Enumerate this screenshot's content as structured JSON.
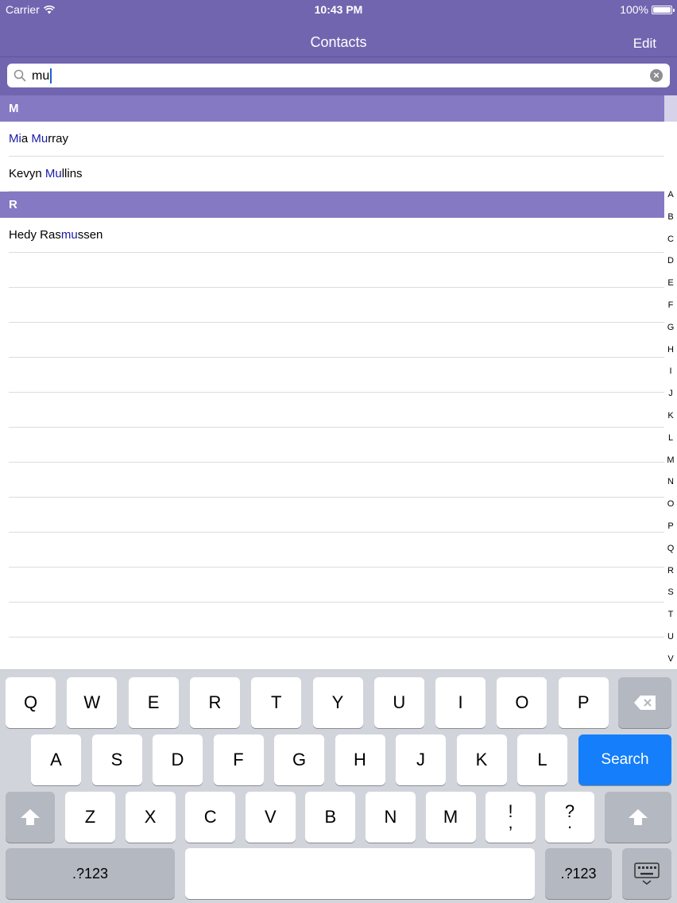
{
  "status_bar": {
    "carrier": "Carrier",
    "time": "10:43 PM",
    "battery": "100%"
  },
  "nav": {
    "title": "Contacts",
    "edit_label": "Edit"
  },
  "search": {
    "query": "mu"
  },
  "sections": [
    {
      "header": "M",
      "rows": [
        {
          "parts": [
            {
              "text": "Mi",
              "hl": true
            },
            {
              "text": "a ",
              "hl": false
            },
            {
              "text": "Mu",
              "hl": true
            },
            {
              "text": "rray",
              "hl": false
            }
          ]
        },
        {
          "parts": [
            {
              "text": "Kevyn ",
              "hl": false
            },
            {
              "text": "Mu",
              "hl": true
            },
            {
              "text": "llins",
              "hl": false
            }
          ]
        }
      ]
    },
    {
      "header": "R",
      "rows": [
        {
          "parts": [
            {
              "text": "Hedy Ras",
              "hl": false
            },
            {
              "text": "mu",
              "hl": true
            },
            {
              "text": "ssen",
              "hl": false
            }
          ]
        }
      ]
    }
  ],
  "empty_rows": 11,
  "index_letters": [
    "A",
    "B",
    "C",
    "D",
    "E",
    "F",
    "G",
    "H",
    "I",
    "J",
    "K",
    "L",
    "M",
    "N",
    "O",
    "P",
    "Q",
    "R",
    "S",
    "T",
    "U",
    "V"
  ],
  "keyboard": {
    "row1": [
      "Q",
      "W",
      "E",
      "R",
      "T",
      "Y",
      "U",
      "I",
      "O",
      "P"
    ],
    "row2": [
      "A",
      "S",
      "D",
      "F",
      "G",
      "H",
      "J",
      "K",
      "L"
    ],
    "row3": [
      "Z",
      "X",
      "C",
      "V",
      "B",
      "N",
      "M"
    ],
    "punct1": {
      "top": "!",
      "bottom": ","
    },
    "punct2": {
      "top": "?",
      "bottom": "."
    },
    "search_label": "Search",
    "numbers_label": ".?123",
    "icons": {
      "backspace": "backspace-icon",
      "shift": "shift-icon",
      "dismiss": "keyboard-dismiss-icon"
    }
  },
  "colors": {
    "nav": "#7165b0",
    "section_header": "#8479c2",
    "highlight": "#1a1aa8",
    "search_key": "#147efb"
  }
}
